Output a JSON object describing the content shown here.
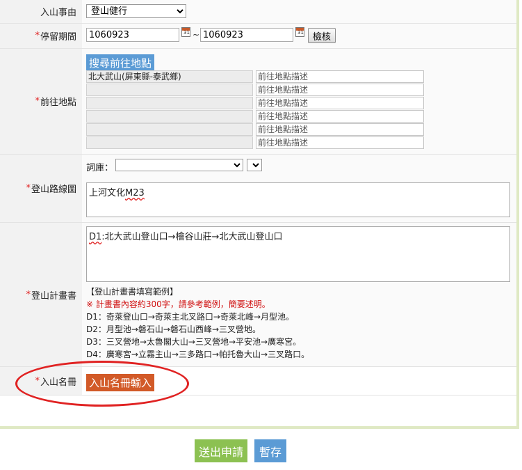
{
  "reason": {
    "label": "入山事由",
    "selected": "登山健行"
  },
  "stay": {
    "label": "停留期間",
    "start": "1060923",
    "end": "1060923",
    "sep": "~",
    "check_btn": "檢核"
  },
  "destination": {
    "label": "前往地點",
    "search_btn": "搜尋前往地點",
    "rows": [
      {
        "place": "北大武山(屏東縣-泰武鄉)",
        "desc": "前往地點描述"
      },
      {
        "place": "",
        "desc": "前往地點描述"
      },
      {
        "place": "",
        "desc": "前往地點描述"
      },
      {
        "place": "",
        "desc": "前往地點描述"
      },
      {
        "place": "",
        "desc": "前往地點描述"
      },
      {
        "place": "",
        "desc": "前往地點描述"
      }
    ]
  },
  "route": {
    "label": "登山路線圖",
    "lexicon_label": "詞庫：",
    "text_main": "上河文化",
    "text_code": "M23"
  },
  "plan": {
    "label": "登山計畫書",
    "text_day": "D1",
    "text_rest": ":北大武山登山口→檜谷山莊→北大武山登山口",
    "example_title": "【登山計畫書填寫範例】",
    "example_note": "※ 計畫書內容約300字，請參考範例，簡要述明。",
    "example_lines": [
      "D1：奇萊登山口→奇萊主北叉路口→奇萊北峰→月型池。",
      "D2：月型池→磐石山→磐石山西峰→三叉營地。",
      "D3：三叉營地→太魯閣大山→三叉營地→平安池→廣寒宮。",
      "D4：廣寒宮→立霧主山→三多路口→帕托魯大山→三叉路口。"
    ]
  },
  "roster": {
    "label": "入山名冊",
    "btn": "入山名冊輸入"
  },
  "footer": {
    "submit": "送出申請",
    "save": "暫存"
  },
  "colors": {
    "accent_blue": "#5b9bd5",
    "accent_green": "#8cc152",
    "accent_orange": "#d25a28",
    "required_red": "#e02020"
  }
}
